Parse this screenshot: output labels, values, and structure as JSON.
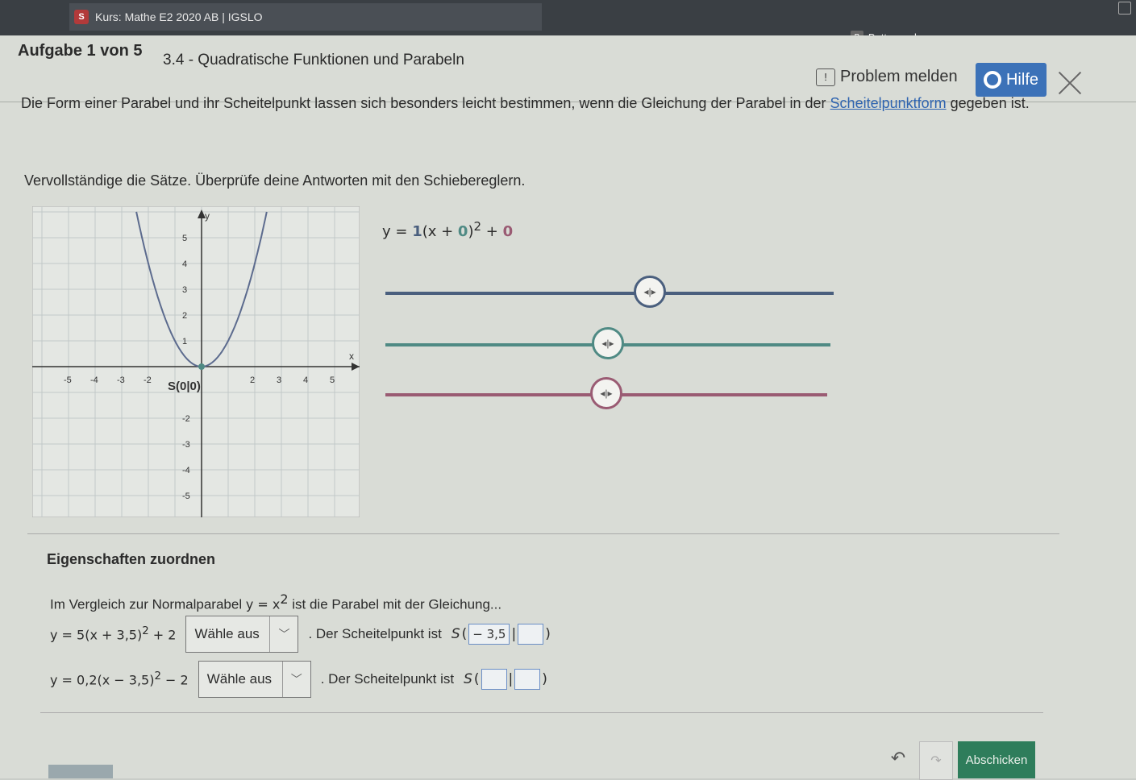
{
  "browser": {
    "tab_title": "Kurs: Mathe E2 2020 AB | IGSLO",
    "tab_icon": "S",
    "bookmarks_label": "Bettermarks",
    "bookmarks_icon": "B"
  },
  "header": {
    "task_number": "Aufgabe 1 von 5",
    "task_title": "3.4 - Quadratische Funktionen und Parabeln",
    "problem_label": "Problem melden",
    "help_label": "Hilfe"
  },
  "content": {
    "intro_text": "Die Form einer Parabel und ihr Scheitelpunkt lassen sich besonders leicht bestimmen, wenn die Gleichung der Parabel in der ",
    "intro_link": "Scheitelpunktform",
    "intro_text_end": " gegeben ist.",
    "instruction": "Vervollständige die Sätze. Überprüfe deine Antworten mit den Schiebereglern.",
    "formula": {
      "prefix": "y = ",
      "a": "1",
      "open": "(x + ",
      "d": "0",
      "close": ")",
      "exp": "2",
      "plus": " + ",
      "e": "0"
    },
    "graph": {
      "x_label": "x",
      "y_label": "y",
      "x_ticks": [
        "-5",
        "-4",
        "-3",
        "-2",
        "2",
        "3",
        "4",
        "5"
      ],
      "y_ticks": [
        "5",
        "4",
        "3",
        "2",
        "1",
        "-2",
        "-3",
        "-4",
        "-5"
      ],
      "vertex_label": "S(0|0)"
    },
    "sliders": [
      {
        "name": "a",
        "color": "#4a5f7e",
        "value_fraction": 0.59
      },
      {
        "name": "d",
        "color": "#4f8a84",
        "value_fraction": 0.5
      },
      {
        "name": "e",
        "color": "#9a5b73",
        "value_fraction": 0.5
      }
    ],
    "section_title": "Eigenschaften zuordnen",
    "compare_text_1": "Im Vergleich zur Normalparabel ",
    "compare_formula": "y = x",
    "compare_exp": "2",
    "compare_text_2": " ist die Parabel mit der Gleichung...",
    "rows": [
      {
        "equation": "y = 5(x + 3,5)",
        "eq_exp": "2",
        "eq_tail": " + 2",
        "select_label": "Wähle aus",
        "vertex_text": ". Der Scheitelpunkt ist ",
        "vertex_s": "S",
        "vertex_x": "− 3,5",
        "vertex_y": ""
      },
      {
        "equation": "y = 0,2(x − 3,5)",
        "eq_exp": "2",
        "eq_tail": " − 2",
        "select_label": "Wähle aus",
        "vertex_text": ". Der Scheitelpunkt ist ",
        "vertex_s": "S",
        "vertex_x": "",
        "vertex_y": ""
      }
    ]
  },
  "footer": {
    "submit_label": "Abschicken",
    "undo_icon": "↶",
    "redo_icon": "↷"
  }
}
